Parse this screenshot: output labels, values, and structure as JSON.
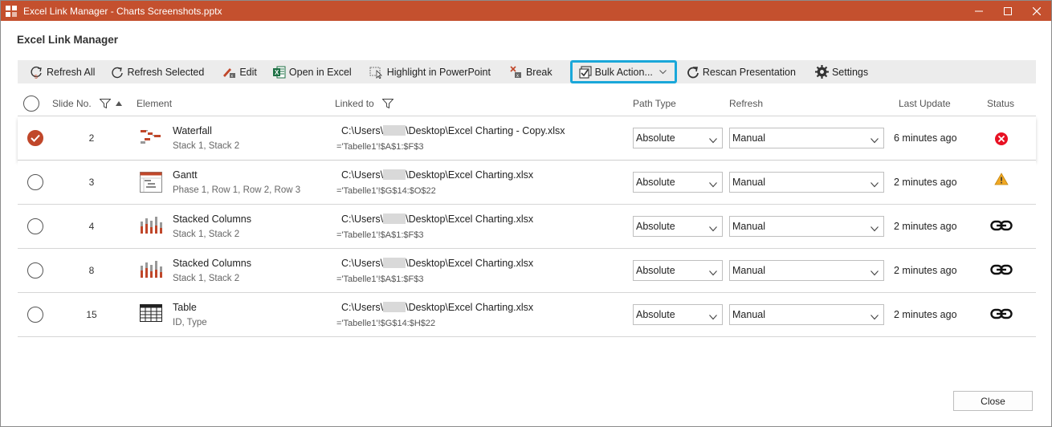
{
  "window": {
    "title": "Excel Link Manager - Charts Screenshots.pptx",
    "controls": [
      "minimize",
      "maximize",
      "close"
    ]
  },
  "dialog": {
    "heading": "Excel Link Manager"
  },
  "toolbar": {
    "refresh_all": "Refresh All",
    "refresh_selected": "Refresh Selected",
    "edit": "Edit",
    "open_in_excel": "Open in Excel",
    "highlight": "Highlight in PowerPoint",
    "break": "Break",
    "bulk_actions": "Bulk Action...",
    "rescan": "Rescan Presentation",
    "settings": "Settings"
  },
  "columns": {
    "slide_no": "Slide No.",
    "element": "Element",
    "linked_to": "Linked to",
    "path_type": "Path Type",
    "refresh": "Refresh",
    "last_update": "Last Update",
    "status": "Status"
  },
  "rows": [
    {
      "selected": true,
      "slide": "2",
      "icon": "waterfall-chart-icon",
      "name": "Waterfall",
      "sub": "Stack 1, Stack 2",
      "path_pre": "C:\\Users\\",
      "path_post": "\\Desktop\\Excel Charting - Copy.xlsx",
      "range": "='Tabelle1'!$A$1:$F$3",
      "path_type": "Absolute",
      "refresh": "Manual",
      "update": "6 minutes ago",
      "status": "error-icon"
    },
    {
      "selected": false,
      "slide": "3",
      "icon": "gantt-chart-icon",
      "name": "Gantt",
      "sub": "Phase 1, Row 1, Row 2, Row 3",
      "path_pre": "C:\\Users\\",
      "path_post": "\\Desktop\\Excel Charting.xlsx",
      "range": "='Tabelle1'!$G$14:$O$22",
      "path_type": "Absolute",
      "refresh": "Manual",
      "update": "2 minutes ago",
      "status": "warning-icon"
    },
    {
      "selected": false,
      "slide": "4",
      "icon": "stacked-columns-icon",
      "name": "Stacked Columns",
      "sub": "Stack 1, Stack 2",
      "path_pre": "C:\\Users\\",
      "path_post": "\\Desktop\\Excel Charting.xlsx",
      "range": "='Tabelle1'!$A$1:$F$3",
      "path_type": "Absolute",
      "refresh": "Manual",
      "update": "2 minutes ago",
      "status": "link-icon"
    },
    {
      "selected": false,
      "slide": "8",
      "icon": "stacked-columns-icon",
      "name": "Stacked Columns",
      "sub": "Stack 1, Stack 2",
      "path_pre": "C:\\Users\\",
      "path_post": "\\Desktop\\Excel Charting.xlsx",
      "range": "='Tabelle1'!$A$1:$F$3",
      "path_type": "Absolute",
      "refresh": "Manual",
      "update": "2 minutes ago",
      "status": "link-icon"
    },
    {
      "selected": false,
      "slide": "15",
      "icon": "table-icon",
      "name": "Table",
      "sub": "ID, Type",
      "path_pre": "C:\\Users\\",
      "path_post": "\\Desktop\\Excel Charting.xlsx",
      "range": "='Tabelle1'!$G$14:$H$22",
      "path_type": "Absolute",
      "refresh": "Manual",
      "update": "2 minutes ago",
      "status": "link-icon"
    }
  ],
  "footer": {
    "close": "Close"
  },
  "colors": {
    "titlebar": "#c4502e",
    "accent": "#c0472a",
    "highlight_border": "#1aa7d9"
  }
}
